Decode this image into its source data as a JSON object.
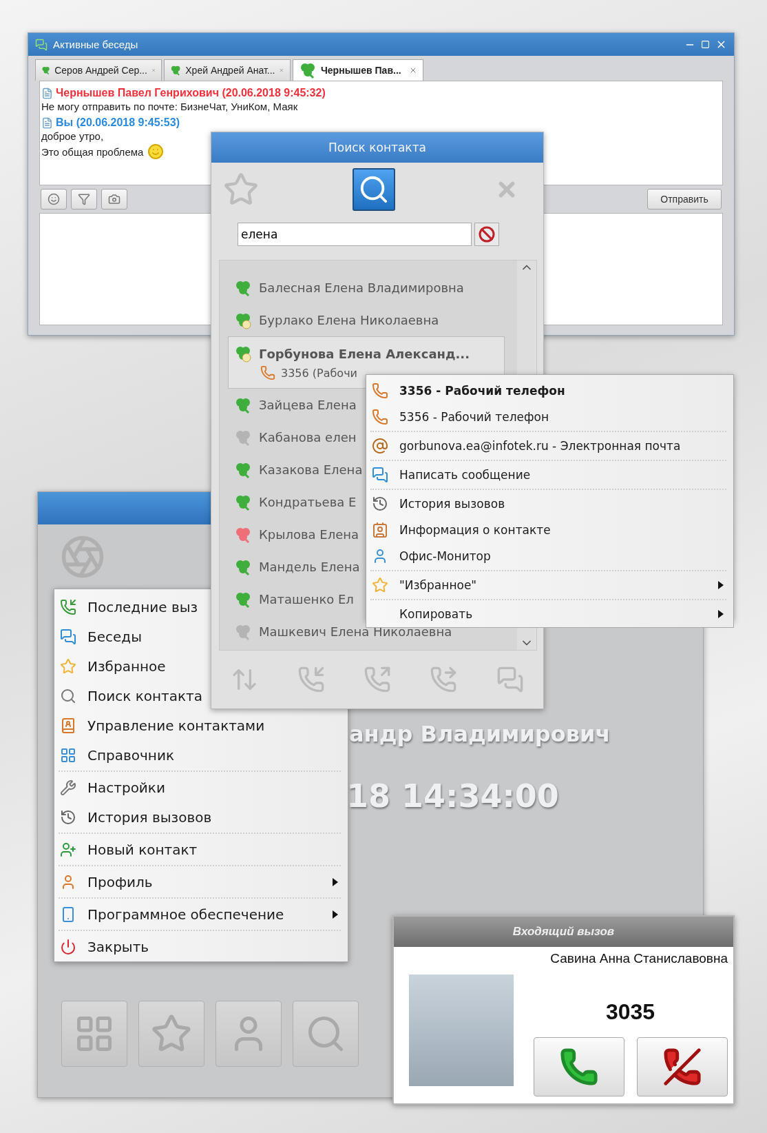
{
  "chat_window": {
    "title": "Активные беседы",
    "tabs": [
      {
        "label": "Серов Андрей Сер...",
        "selected": false
      },
      {
        "label": "Хрей Андрей Анат...",
        "selected": false
      },
      {
        "label": "Чернышев Пав...",
        "selected": true
      }
    ],
    "messages": [
      {
        "kind": "incoming",
        "author": "Чернышев Павел Генрихович (20.06.2018 9:45:32)",
        "lines": [
          "Не могу отправить по почте: БизнеЧат, УниКом, Маяк"
        ],
        "emoticon": false
      },
      {
        "kind": "outgoing",
        "author": "Вы (20.06.2018 9:45:53)",
        "lines": [
          "доброе утро,",
          "Это общая проблема"
        ],
        "emoticon": true
      }
    ],
    "send_button": "Отправить"
  },
  "main_window": {
    "name_text": "андр Владимирович",
    "time_text": "18 14:34:00"
  },
  "main_menu": {
    "sections": [
      [
        {
          "label": "Последние выз",
          "kind": "recent"
        },
        {
          "label": "Беседы",
          "kind": "chats"
        },
        {
          "label": "Избранное",
          "kind": "star"
        },
        {
          "label": "Поиск контакта",
          "kind": "search"
        },
        {
          "label": "Управление контактами",
          "kind": "manage",
          "submenu": false
        },
        {
          "label": "Справочник",
          "kind": "directory",
          "submenu": false
        }
      ],
      [
        {
          "label": "Настройки",
          "kind": "settings",
          "submenu": false
        },
        {
          "label": "История вызовов",
          "kind": "history",
          "submenu": false
        }
      ],
      [
        {
          "label": "Новый контакт",
          "kind": "new_contact",
          "submenu": false
        }
      ],
      [
        {
          "label": "Профиль",
          "kind": "profile",
          "submenu": true
        }
      ],
      [
        {
          "label": "Программное обеспечение",
          "kind": "software",
          "submenu": true
        }
      ],
      [
        {
          "label": "Закрыть",
          "kind": "close",
          "submenu": false
        }
      ]
    ]
  },
  "search_window": {
    "title": "Поиск контакта",
    "query": "елена",
    "contacts": [
      {
        "name": "Балесная Елена Владимировна",
        "kind": "online",
        "selected": false
      },
      {
        "name": "Бурлако Елена Николаевна",
        "kind": "na",
        "selected": false
      },
      {
        "name": "Горбунова Елена Александ...",
        "kind": "na",
        "selected": true,
        "phone": "3356 (Рабочи"
      },
      {
        "name": "Зайцева Елена",
        "kind": "online",
        "selected": false
      },
      {
        "name": "Кабанова елен",
        "kind": "offline",
        "selected": false
      },
      {
        "name": "Казакова Елена",
        "kind": "online",
        "selected": false
      },
      {
        "name": "Кондратьева Е",
        "kind": "online",
        "selected": false
      },
      {
        "name": "Крылова Елена",
        "kind": "busy",
        "selected": false
      },
      {
        "name": "Мандель Елена",
        "kind": "online",
        "selected": false
      },
      {
        "name": "Маташенко Ел",
        "kind": "online",
        "selected": false
      },
      {
        "name": "Машкевич Елена Николаевна",
        "kind": "offline",
        "selected": false
      }
    ]
  },
  "context_menu": {
    "sections": [
      [
        {
          "label": "3356 - Рабочий телефон",
          "kind": "phone",
          "default": true,
          "submenu": false
        },
        {
          "label": "5356 - Рабочий телефон",
          "kind": "phone",
          "default": false,
          "submenu": false
        }
      ],
      [
        {
          "label": "gorbunova.ea@infotek.ru - Электронная почта",
          "kind": "email",
          "default": false,
          "submenu": false
        }
      ],
      [
        {
          "label": "Написать сообщение",
          "kind": "chat",
          "default": false,
          "submenu": false
        }
      ],
      [
        {
          "label": "История вызовов",
          "kind": "history",
          "default": false,
          "submenu": false
        },
        {
          "label": "Информация о контакте",
          "kind": "card",
          "default": false,
          "submenu": false
        },
        {
          "label": "Офис-Монитор",
          "kind": "monitor",
          "default": false,
          "submenu": false
        }
      ],
      [
        {
          "label": "\"Избранное\"",
          "kind": "star",
          "default": false,
          "submenu": true
        }
      ],
      [
        {
          "label": "Копировать",
          "kind": "none",
          "default": false,
          "submenu": true
        }
      ]
    ]
  },
  "incoming_call": {
    "title": "Входящий вызов",
    "caller": "Савина Анна Станиславовна",
    "number": "3035"
  }
}
